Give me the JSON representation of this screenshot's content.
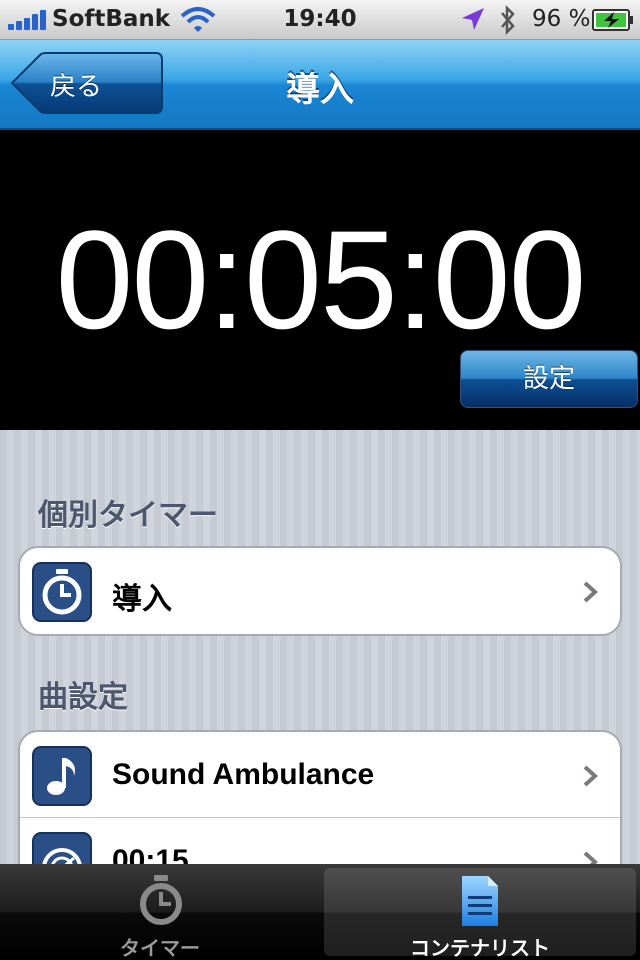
{
  "status_bar": {
    "carrier": "SoftBank",
    "time": "19:40",
    "battery_percent": "96 %"
  },
  "nav": {
    "title": "導入",
    "back_label": "戻る"
  },
  "timer": {
    "display": "00:05:00",
    "settings_label": "設定"
  },
  "sections": [
    {
      "header": "個別タイマー",
      "items": [
        {
          "label": "導入",
          "icon": "stopwatch-icon"
        }
      ]
    },
    {
      "header": "曲設定",
      "items": [
        {
          "label": "Sound Ambulance",
          "icon": "music-note-icon"
        },
        {
          "label": "00:15",
          "icon": "interval-timer-icon"
        }
      ]
    }
  ],
  "tab_bar": {
    "tabs": [
      {
        "label": "タイマー",
        "icon": "stopwatch-icon",
        "selected": false
      },
      {
        "label": "コンテナリスト",
        "icon": "document-icon",
        "selected": true
      }
    ]
  },
  "colors": {
    "nav_blue": "#1a86d4",
    "list_background": "#c7ccd5",
    "section_header": "#4c566c",
    "icon_blue": "#2a4f86"
  }
}
